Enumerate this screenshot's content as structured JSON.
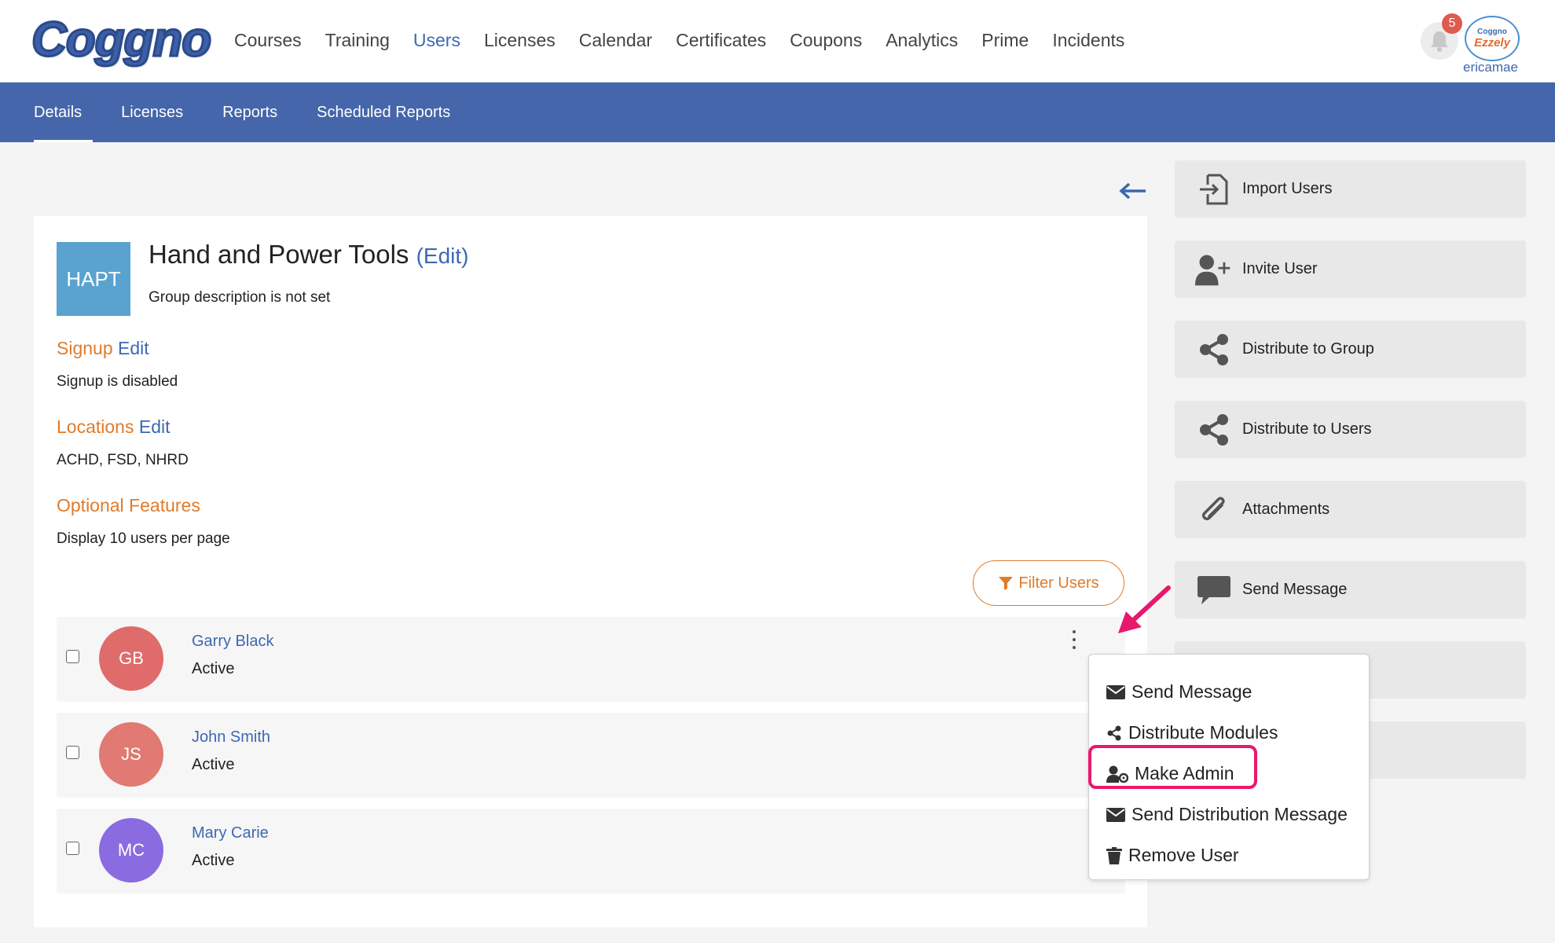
{
  "nav": {
    "logo": "Coggno",
    "items": [
      "Courses",
      "Training",
      "Users",
      "Licenses",
      "Calendar",
      "Certificates",
      "Coupons",
      "Analytics",
      "Prime",
      "Incidents"
    ],
    "active": "Users",
    "notifications": "5",
    "user_logo_top": "Coggno",
    "user_logo_bottom": "Ezzely",
    "username": "ericamae"
  },
  "subnav": {
    "items": [
      "Details",
      "Licenses",
      "Reports",
      "Scheduled Reports"
    ],
    "active": "Details"
  },
  "group": {
    "icon": "HAPT",
    "title": "Hand and Power Tools",
    "edit": "(Edit)",
    "description": "Group description is not set"
  },
  "signup": {
    "title": "Signup",
    "edit": "Edit",
    "text": "Signup is disabled"
  },
  "locations": {
    "title": "Locations",
    "edit": "Edit",
    "text": "ACHD, FSD, NHRD"
  },
  "optional": {
    "title": "Optional Features",
    "text": "Display 10 users per page"
  },
  "filter_label": "Filter Users",
  "users": [
    {
      "initials": "GB",
      "name": "Garry Black",
      "status": "Active",
      "color": "#e06b6b"
    },
    {
      "initials": "JS",
      "name": "John Smith",
      "status": "Active",
      "color": "#e07a72"
    },
    {
      "initials": "MC",
      "name": "Mary Carie",
      "status": "Active",
      "color": "#8a6be0"
    }
  ],
  "actions": [
    "Import Users",
    "Invite User",
    "Distribute to Group",
    "Distribute to Users",
    "Attachments",
    "Send Message"
  ],
  "menu": [
    "Send Message",
    "Distribute Modules",
    "Make Admin",
    "Send Distribution Message",
    "Remove User"
  ],
  "colors": {
    "accent": "#3d68b1",
    "subbar": "#4566aa",
    "orange": "#e07b2a",
    "highlight": "#e8196c"
  }
}
